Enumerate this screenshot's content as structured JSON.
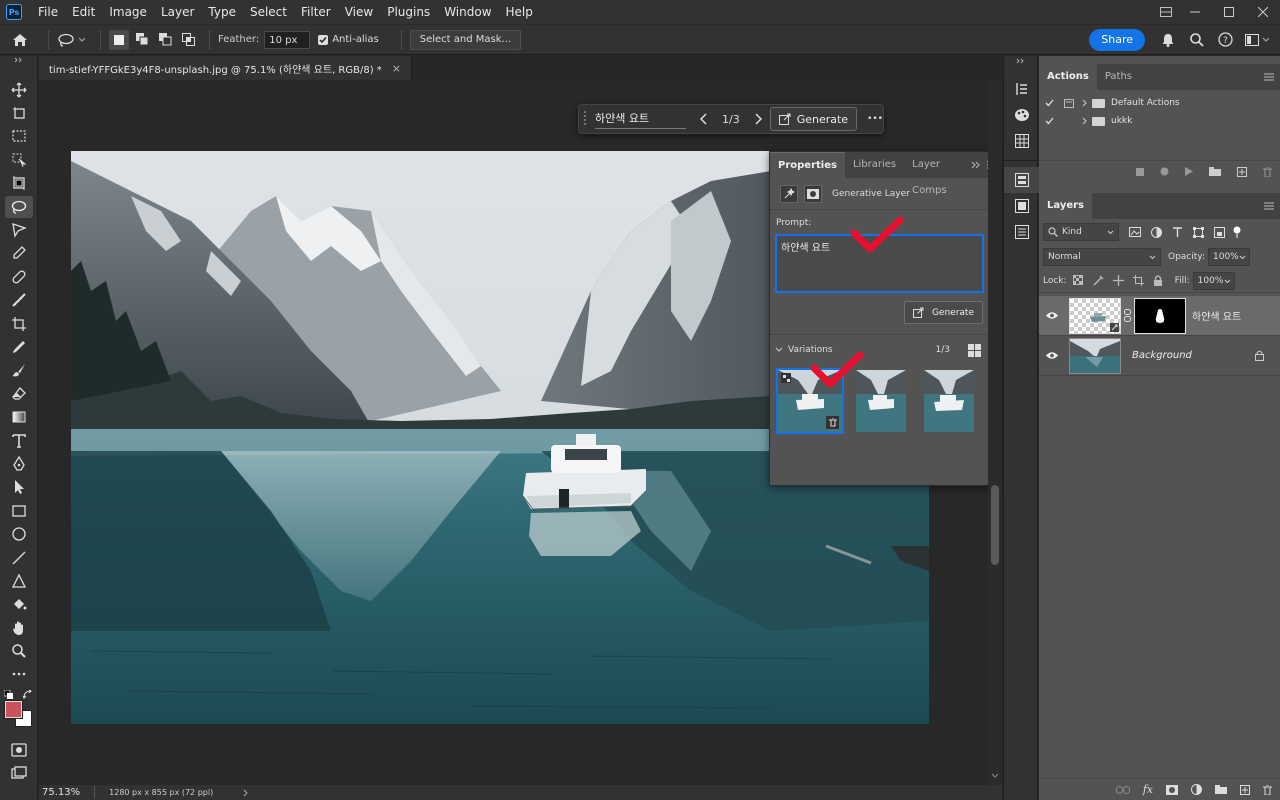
{
  "app": {
    "logo": "Ps",
    "menu": [
      "File",
      "Edit",
      "Image",
      "Layer",
      "Type",
      "Select",
      "Filter",
      "View",
      "Plugins",
      "Window",
      "Help"
    ]
  },
  "options_bar": {
    "feather_label": "Feather:",
    "feather_value": "10 px",
    "anti_alias_label": "Anti-alias",
    "select_mask_label": "Select and Mask...",
    "share_label": "Share"
  },
  "document": {
    "tab_title": "tim-stief-YFFGkE3y4F8-unsplash.jpg @ 75.1% (하얀색 요트, RGB/8) *",
    "close": "×",
    "zoom": "75.13%",
    "info": "1280 px x 855 px (72 ppi)"
  },
  "taskbar": {
    "prompt": "하얀색 요트",
    "counter": "1/3",
    "generate_label": "Generate",
    "more": "•••"
  },
  "properties": {
    "tabs": [
      "Properties",
      "Libraries",
      "Layer Comps"
    ],
    "layer_type": "Generative Layer",
    "prompt_label": "Prompt:",
    "prompt_value": "하얀색 요트",
    "generate_label": "Generate",
    "variations_label": "Variations",
    "variations_count": "1/3",
    "selected_variation": 1
  },
  "actions_panel": {
    "tabs": [
      "Actions",
      "Paths"
    ],
    "items": [
      {
        "name": "Default Actions"
      },
      {
        "name": "ukkk"
      }
    ]
  },
  "layers_panel": {
    "title": "Layers",
    "filter_kind": "Kind",
    "blend_mode": "Normal",
    "opacity_label": "Opacity:",
    "opacity_value": "100%",
    "lock_label": "Lock:",
    "fill_label": "Fill:",
    "fill_value": "100%",
    "layers": [
      {
        "name": "하얀색 요트",
        "selected": true
      },
      {
        "name": "Background",
        "selected": false
      }
    ]
  },
  "colors": {
    "accent": "#1473e6",
    "foreground_swatch": "#c9525f",
    "background_swatch": "#ffffff",
    "highlight_check": "#e8102e"
  }
}
